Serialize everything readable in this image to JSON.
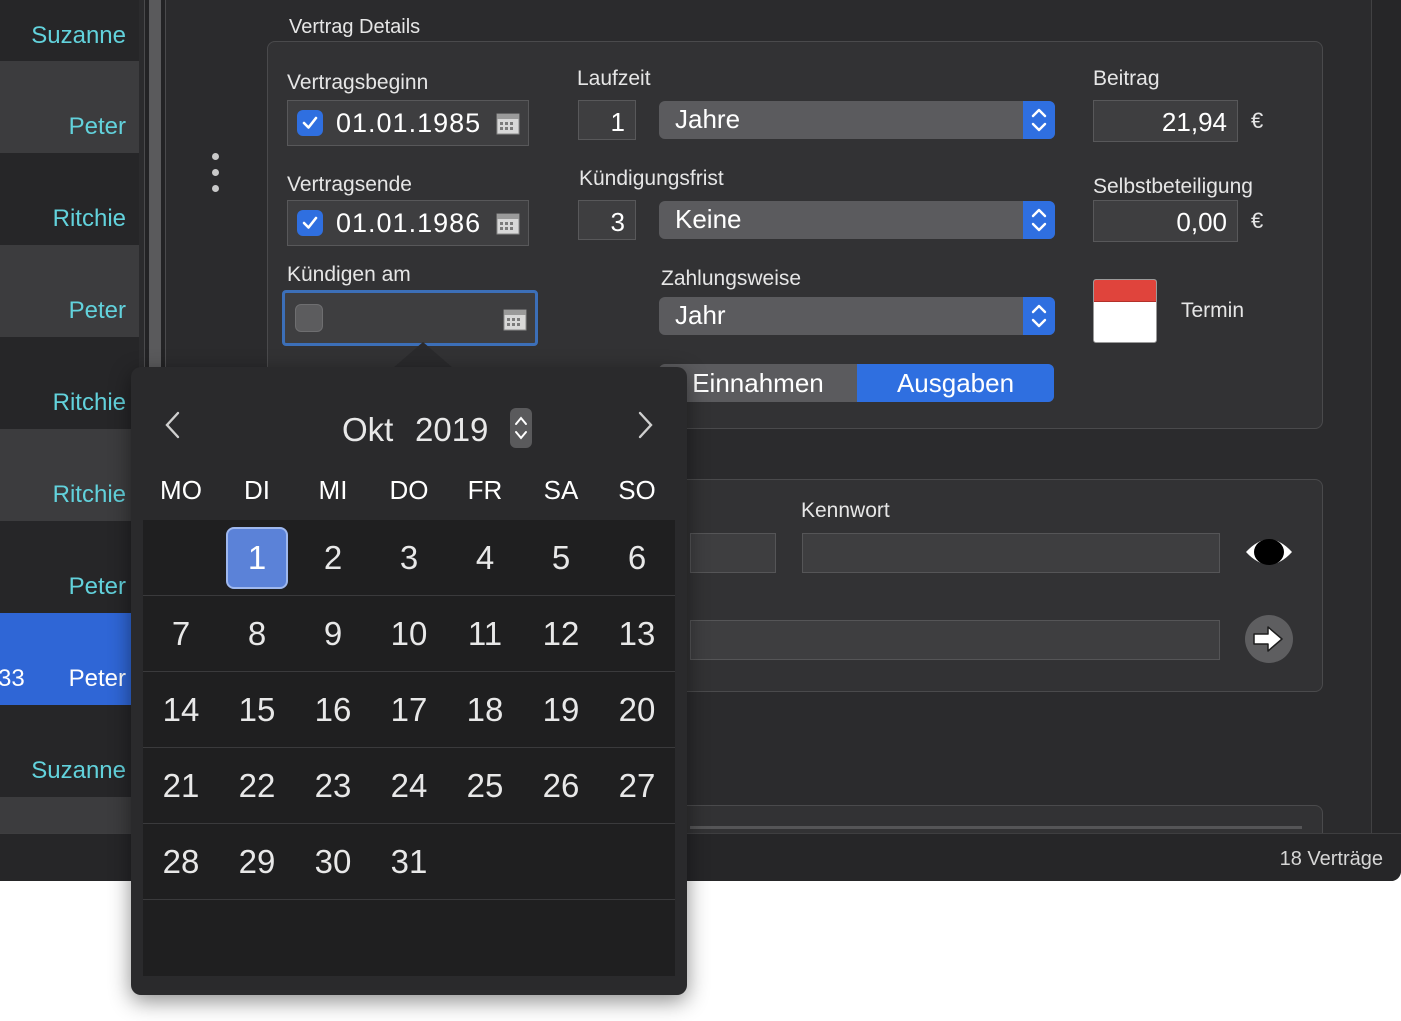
{
  "sidebar": {
    "rows": [
      {
        "name": "Suzanne"
      },
      {
        "name": "Peter"
      },
      {
        "name": "Ritchie"
      },
      {
        "name": "Peter"
      },
      {
        "name": "Ritchie"
      },
      {
        "name": "Ritchie"
      },
      {
        "name": "Peter"
      },
      {
        "name": "Peter",
        "number": "33"
      },
      {
        "name": "Suzanne"
      }
    ]
  },
  "details": {
    "title": "Vertrag Details",
    "vertragsbeginn": {
      "label": "Vertragsbeginn",
      "value": "01.01.1985",
      "checked": true
    },
    "vertragsende": {
      "label": "Vertragsende",
      "value": "01.01.1986",
      "checked": true
    },
    "kuendigen": {
      "label": "Kündigen am",
      "value": "",
      "checked": false
    },
    "laufzeit": {
      "label": "Laufzeit",
      "value": "1",
      "unit": "Jahre"
    },
    "kuendigungsfrist": {
      "label": "Kündigungsfrist",
      "value": "3",
      "unit": "Keine"
    },
    "zahlungsweise": {
      "label": "Zahlungsweise",
      "value": "Jahr"
    },
    "beitrag": {
      "label": "Beitrag",
      "value": "21,94",
      "currency": "€"
    },
    "selbstbeteiligung": {
      "label": "Selbstbeteiligung",
      "value": "0,00",
      "currency": "€"
    },
    "termin": {
      "label": "Termin"
    },
    "segment": {
      "options": [
        "Einnahmen",
        "Ausgaben"
      ],
      "selected": "Ausgaben"
    }
  },
  "login": {
    "kennwort_label": "Kennwort"
  },
  "status": {
    "count": "18 Verträge"
  },
  "calendar": {
    "month": "Okt",
    "year": "2019",
    "weekdays": [
      "MO",
      "DI",
      "MI",
      "DO",
      "FR",
      "SA",
      "SO"
    ],
    "selected_day": "1",
    "weeks": [
      [
        "",
        "1",
        "2",
        "3",
        "4",
        "5",
        "6"
      ],
      [
        "7",
        "8",
        "9",
        "10",
        "11",
        "12",
        "13"
      ],
      [
        "14",
        "15",
        "16",
        "17",
        "18",
        "19",
        "20"
      ],
      [
        "21",
        "22",
        "23",
        "24",
        "25",
        "26",
        "27"
      ],
      [
        "28",
        "29",
        "30",
        "31",
        "",
        "",
        ""
      ]
    ]
  },
  "colors": {
    "accent": "#2f6fe0",
    "name_text": "#62d2dc",
    "selection": "#2f66d6"
  }
}
